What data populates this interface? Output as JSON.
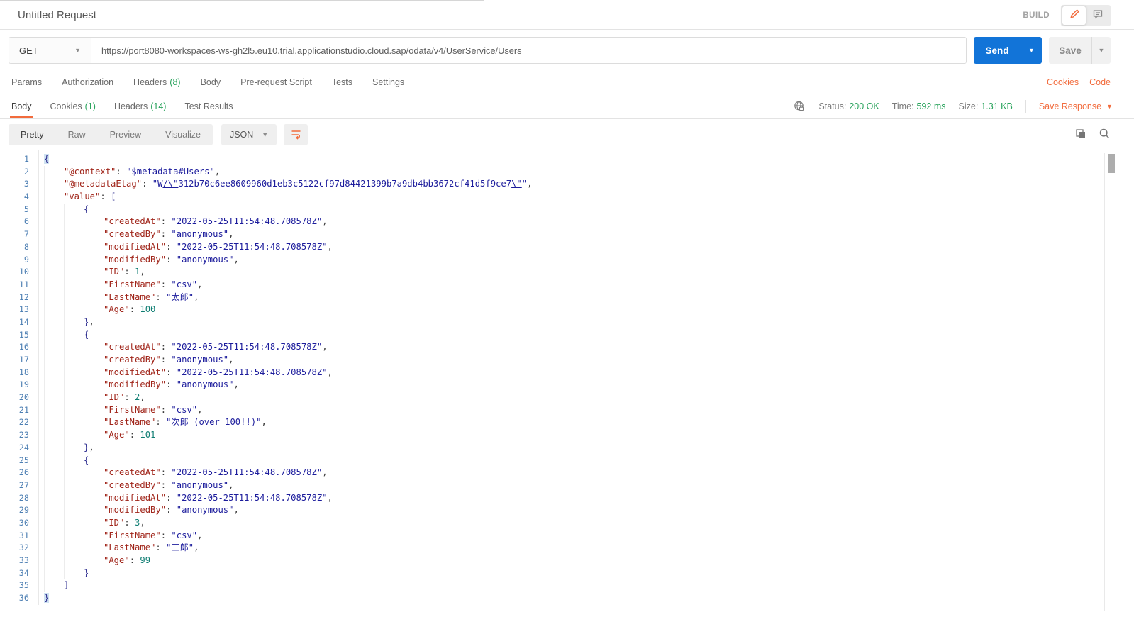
{
  "header": {
    "title": "Untitled Request",
    "build_label": "BUILD"
  },
  "request": {
    "method": "GET",
    "url": "https://port8080-workspaces-ws-gh2l5.eu10.trial.applicationstudio.cloud.sap/odata/v4/UserService/Users",
    "send_label": "Send",
    "save_label": "Save"
  },
  "request_tabs": [
    {
      "label": "Params"
    },
    {
      "label": "Authorization"
    },
    {
      "label": "Headers",
      "count": "(8)"
    },
    {
      "label": "Body"
    },
    {
      "label": "Pre-request Script"
    },
    {
      "label": "Tests"
    },
    {
      "label": "Settings"
    }
  ],
  "request_links": {
    "cookies": "Cookies",
    "code": "Code"
  },
  "response": {
    "tabs": [
      {
        "label": "Body",
        "active": true
      },
      {
        "label": "Cookies",
        "count": "(1)"
      },
      {
        "label": "Headers",
        "count": "(14)"
      },
      {
        "label": "Test Results"
      }
    ],
    "status": {
      "label": "Status:",
      "value": "200 OK"
    },
    "time": {
      "label": "Time:",
      "value": "592 ms"
    },
    "size": {
      "label": "Size:",
      "value": "1.31 KB"
    },
    "save_response_label": "Save Response"
  },
  "viewer": {
    "modes": [
      "Pretty",
      "Raw",
      "Preview",
      "Visualize"
    ],
    "active_mode_index": 0,
    "format": "JSON"
  },
  "colors": {
    "accent_orange": "#f26b3c",
    "success_green": "#29a35c",
    "primary_blue": "#1274d8"
  },
  "code": {
    "lines": [
      {
        "i": 0,
        "t": [
          [
            "m",
            "{"
          ]
        ]
      },
      {
        "i": 1,
        "t": [
          [
            "k",
            "\"@context\""
          ],
          [
            "p",
            ": "
          ],
          [
            "s",
            "\"$metadata#Users\""
          ],
          [
            "p",
            ","
          ]
        ]
      },
      {
        "i": 1,
        "t": [
          [
            "k",
            "\"@metadataEtag\""
          ],
          [
            "p",
            ": "
          ],
          [
            "s",
            "\"W"
          ],
          [
            "e",
            "/\\\""
          ],
          [
            "s",
            "312b70c6ee8609960d1eb3c5122cf97d84421399b7a9db4bb3672cf41d5f9ce7"
          ],
          [
            "e",
            "\\\""
          ],
          [
            "s",
            "\""
          ],
          [
            "p",
            ","
          ]
        ]
      },
      {
        "i": 1,
        "t": [
          [
            "k",
            "\"value\""
          ],
          [
            "p",
            ": "
          ],
          [
            "b",
            "["
          ]
        ]
      },
      {
        "i": 2,
        "t": [
          [
            "b",
            "{"
          ]
        ]
      },
      {
        "i": 3,
        "t": [
          [
            "k",
            "\"createdAt\""
          ],
          [
            "p",
            ": "
          ],
          [
            "s",
            "\"2022-05-25T11:54:48.708578Z\""
          ],
          [
            "p",
            ","
          ]
        ]
      },
      {
        "i": 3,
        "t": [
          [
            "k",
            "\"createdBy\""
          ],
          [
            "p",
            ": "
          ],
          [
            "s",
            "\"anonymous\""
          ],
          [
            "p",
            ","
          ]
        ]
      },
      {
        "i": 3,
        "t": [
          [
            "k",
            "\"modifiedAt\""
          ],
          [
            "p",
            ": "
          ],
          [
            "s",
            "\"2022-05-25T11:54:48.708578Z\""
          ],
          [
            "p",
            ","
          ]
        ]
      },
      {
        "i": 3,
        "t": [
          [
            "k",
            "\"modifiedBy\""
          ],
          [
            "p",
            ": "
          ],
          [
            "s",
            "\"anonymous\""
          ],
          [
            "p",
            ","
          ]
        ]
      },
      {
        "i": 3,
        "t": [
          [
            "k",
            "\"ID\""
          ],
          [
            "p",
            ": "
          ],
          [
            "n",
            "1"
          ],
          [
            "p",
            ","
          ]
        ]
      },
      {
        "i": 3,
        "t": [
          [
            "k",
            "\"FirstName\""
          ],
          [
            "p",
            ": "
          ],
          [
            "s",
            "\"csv\""
          ],
          [
            "p",
            ","
          ]
        ]
      },
      {
        "i": 3,
        "t": [
          [
            "k",
            "\"LastName\""
          ],
          [
            "p",
            ": "
          ],
          [
            "s",
            "\"太郎\""
          ],
          [
            "p",
            ","
          ]
        ]
      },
      {
        "i": 3,
        "t": [
          [
            "k",
            "\"Age\""
          ],
          [
            "p",
            ": "
          ],
          [
            "n",
            "100"
          ]
        ]
      },
      {
        "i": 2,
        "t": [
          [
            "b",
            "}"
          ],
          [
            "p",
            ","
          ]
        ]
      },
      {
        "i": 2,
        "t": [
          [
            "b",
            "{"
          ]
        ]
      },
      {
        "i": 3,
        "t": [
          [
            "k",
            "\"createdAt\""
          ],
          [
            "p",
            ": "
          ],
          [
            "s",
            "\"2022-05-25T11:54:48.708578Z\""
          ],
          [
            "p",
            ","
          ]
        ]
      },
      {
        "i": 3,
        "t": [
          [
            "k",
            "\"createdBy\""
          ],
          [
            "p",
            ": "
          ],
          [
            "s",
            "\"anonymous\""
          ],
          [
            "p",
            ","
          ]
        ]
      },
      {
        "i": 3,
        "t": [
          [
            "k",
            "\"modifiedAt\""
          ],
          [
            "p",
            ": "
          ],
          [
            "s",
            "\"2022-05-25T11:54:48.708578Z\""
          ],
          [
            "p",
            ","
          ]
        ]
      },
      {
        "i": 3,
        "t": [
          [
            "k",
            "\"modifiedBy\""
          ],
          [
            "p",
            ": "
          ],
          [
            "s",
            "\"anonymous\""
          ],
          [
            "p",
            ","
          ]
        ]
      },
      {
        "i": 3,
        "t": [
          [
            "k",
            "\"ID\""
          ],
          [
            "p",
            ": "
          ],
          [
            "n",
            "2"
          ],
          [
            "p",
            ","
          ]
        ]
      },
      {
        "i": 3,
        "t": [
          [
            "k",
            "\"FirstName\""
          ],
          [
            "p",
            ": "
          ],
          [
            "s",
            "\"csv\""
          ],
          [
            "p",
            ","
          ]
        ]
      },
      {
        "i": 3,
        "t": [
          [
            "k",
            "\"LastName\""
          ],
          [
            "p",
            ": "
          ],
          [
            "s",
            "\"次郎 (over 100!!)\""
          ],
          [
            "p",
            ","
          ]
        ]
      },
      {
        "i": 3,
        "t": [
          [
            "k",
            "\"Age\""
          ],
          [
            "p",
            ": "
          ],
          [
            "n",
            "101"
          ]
        ]
      },
      {
        "i": 2,
        "t": [
          [
            "b",
            "}"
          ],
          [
            "p",
            ","
          ]
        ]
      },
      {
        "i": 2,
        "t": [
          [
            "b",
            "{"
          ]
        ]
      },
      {
        "i": 3,
        "t": [
          [
            "k",
            "\"createdAt\""
          ],
          [
            "p",
            ": "
          ],
          [
            "s",
            "\"2022-05-25T11:54:48.708578Z\""
          ],
          [
            "p",
            ","
          ]
        ]
      },
      {
        "i": 3,
        "t": [
          [
            "k",
            "\"createdBy\""
          ],
          [
            "p",
            ": "
          ],
          [
            "s",
            "\"anonymous\""
          ],
          [
            "p",
            ","
          ]
        ]
      },
      {
        "i": 3,
        "t": [
          [
            "k",
            "\"modifiedAt\""
          ],
          [
            "p",
            ": "
          ],
          [
            "s",
            "\"2022-05-25T11:54:48.708578Z\""
          ],
          [
            "p",
            ","
          ]
        ]
      },
      {
        "i": 3,
        "t": [
          [
            "k",
            "\"modifiedBy\""
          ],
          [
            "p",
            ": "
          ],
          [
            "s",
            "\"anonymous\""
          ],
          [
            "p",
            ","
          ]
        ]
      },
      {
        "i": 3,
        "t": [
          [
            "k",
            "\"ID\""
          ],
          [
            "p",
            ": "
          ],
          [
            "n",
            "3"
          ],
          [
            "p",
            ","
          ]
        ]
      },
      {
        "i": 3,
        "t": [
          [
            "k",
            "\"FirstName\""
          ],
          [
            "p",
            ": "
          ],
          [
            "s",
            "\"csv\""
          ],
          [
            "p",
            ","
          ]
        ]
      },
      {
        "i": 3,
        "t": [
          [
            "k",
            "\"LastName\""
          ],
          [
            "p",
            ": "
          ],
          [
            "s",
            "\"三郎\""
          ],
          [
            "p",
            ","
          ]
        ]
      },
      {
        "i": 3,
        "t": [
          [
            "k",
            "\"Age\""
          ],
          [
            "p",
            ": "
          ],
          [
            "n",
            "99"
          ]
        ]
      },
      {
        "i": 2,
        "t": [
          [
            "b",
            "}"
          ]
        ]
      },
      {
        "i": 1,
        "t": [
          [
            "b",
            "]"
          ]
        ]
      },
      {
        "i": 0,
        "t": [
          [
            "m",
            "}"
          ]
        ]
      }
    ]
  }
}
